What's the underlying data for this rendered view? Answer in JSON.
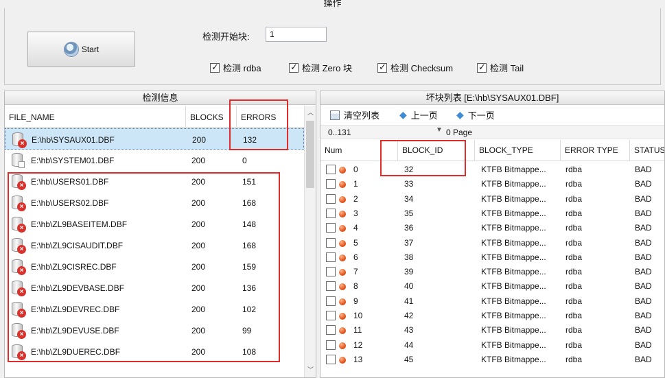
{
  "operations": {
    "title": "操作",
    "start_button": "Start",
    "start_block_label": "检测开始块:",
    "start_block_value": "1",
    "checkboxes": [
      {
        "label": "检测 rdba",
        "checked": true
      },
      {
        "label": "检测 Zero 块",
        "checked": true
      },
      {
        "label": "检测 Checksum",
        "checked": true
      },
      {
        "label": "检测 Tail",
        "checked": true
      }
    ]
  },
  "check_info": {
    "title": "检测信息",
    "columns": [
      "FILE_NAME",
      "BLOCKS",
      "ERRORS"
    ],
    "rows": [
      {
        "file": "E:\\hb\\SYSAUX01.DBF",
        "blocks": "200",
        "errors": "132",
        "status": "error",
        "selected": true
      },
      {
        "file": "E:\\hb\\SYSTEM01.DBF",
        "blocks": "200",
        "errors": "0",
        "status": "ok"
      },
      {
        "file": "E:\\hb\\USERS01.DBF",
        "blocks": "200",
        "errors": "151",
        "status": "error"
      },
      {
        "file": "E:\\hb\\USERS02.DBF",
        "blocks": "200",
        "errors": "168",
        "status": "error"
      },
      {
        "file": "E:\\hb\\ZL9BASEITEM.DBF",
        "blocks": "200",
        "errors": "148",
        "status": "error"
      },
      {
        "file": "E:\\hb\\ZL9CISAUDIT.DBF",
        "blocks": "200",
        "errors": "168",
        "status": "error"
      },
      {
        "file": "E:\\hb\\ZL9CISREC.DBF",
        "blocks": "200",
        "errors": "159",
        "status": "error"
      },
      {
        "file": "E:\\hb\\ZL9DEVBASE.DBF",
        "blocks": "200",
        "errors": "136",
        "status": "error"
      },
      {
        "file": "E:\\hb\\ZL9DEVREC.DBF",
        "blocks": "200",
        "errors": "102",
        "status": "error"
      },
      {
        "file": "E:\\hb\\ZL9DEVUSE.DBF",
        "blocks": "200",
        "errors": "99",
        "status": "error"
      },
      {
        "file": "E:\\hb\\ZL9DUEREC.DBF",
        "blocks": "200",
        "errors": "108",
        "status": "error"
      }
    ]
  },
  "bad_blocks": {
    "title": "坏块列表 [E:\\hb\\SYSAUX01.DBF]",
    "toolbar": {
      "clear": "清空列表",
      "prev": "上一页",
      "next": "下一页"
    },
    "range_value": "0..131",
    "page_label": "0 Page",
    "columns": [
      "Num",
      "BLOCK_ID",
      "BLOCK_TYPE",
      "ERROR TYPE",
      "STATUS"
    ],
    "rows": [
      {
        "num": "0",
        "block_id": "32",
        "type": "KTFB Bitmappe...",
        "error": "rdba",
        "status": "BAD"
      },
      {
        "num": "1",
        "block_id": "33",
        "type": "KTFB Bitmappe...",
        "error": "rdba",
        "status": "BAD"
      },
      {
        "num": "2",
        "block_id": "34",
        "type": "KTFB Bitmappe...",
        "error": "rdba",
        "status": "BAD"
      },
      {
        "num": "3",
        "block_id": "35",
        "type": "KTFB Bitmappe...",
        "error": "rdba",
        "status": "BAD"
      },
      {
        "num": "4",
        "block_id": "36",
        "type": "KTFB Bitmappe...",
        "error": "rdba",
        "status": "BAD"
      },
      {
        "num": "5",
        "block_id": "37",
        "type": "KTFB Bitmappe...",
        "error": "rdba",
        "status": "BAD"
      },
      {
        "num": "6",
        "block_id": "38",
        "type": "KTFB Bitmappe...",
        "error": "rdba",
        "status": "BAD"
      },
      {
        "num": "7",
        "block_id": "39",
        "type": "KTFB Bitmappe...",
        "error": "rdba",
        "status": "BAD"
      },
      {
        "num": "8",
        "block_id": "40",
        "type": "KTFB Bitmappe...",
        "error": "rdba",
        "status": "BAD"
      },
      {
        "num": "9",
        "block_id": "41",
        "type": "KTFB Bitmappe...",
        "error": "rdba",
        "status": "BAD"
      },
      {
        "num": "10",
        "block_id": "42",
        "type": "KTFB Bitmappe...",
        "error": "rdba",
        "status": "BAD"
      },
      {
        "num": "11",
        "block_id": "43",
        "type": "KTFB Bitmappe...",
        "error": "rdba",
        "status": "BAD"
      },
      {
        "num": "12",
        "block_id": "44",
        "type": "KTFB Bitmappe...",
        "error": "rdba",
        "status": "BAD"
      },
      {
        "num": "13",
        "block_id": "45",
        "type": "KTFB Bitmappe...",
        "error": "rdba",
        "status": "BAD"
      }
    ]
  },
  "highlight_color": "#e02b2b"
}
